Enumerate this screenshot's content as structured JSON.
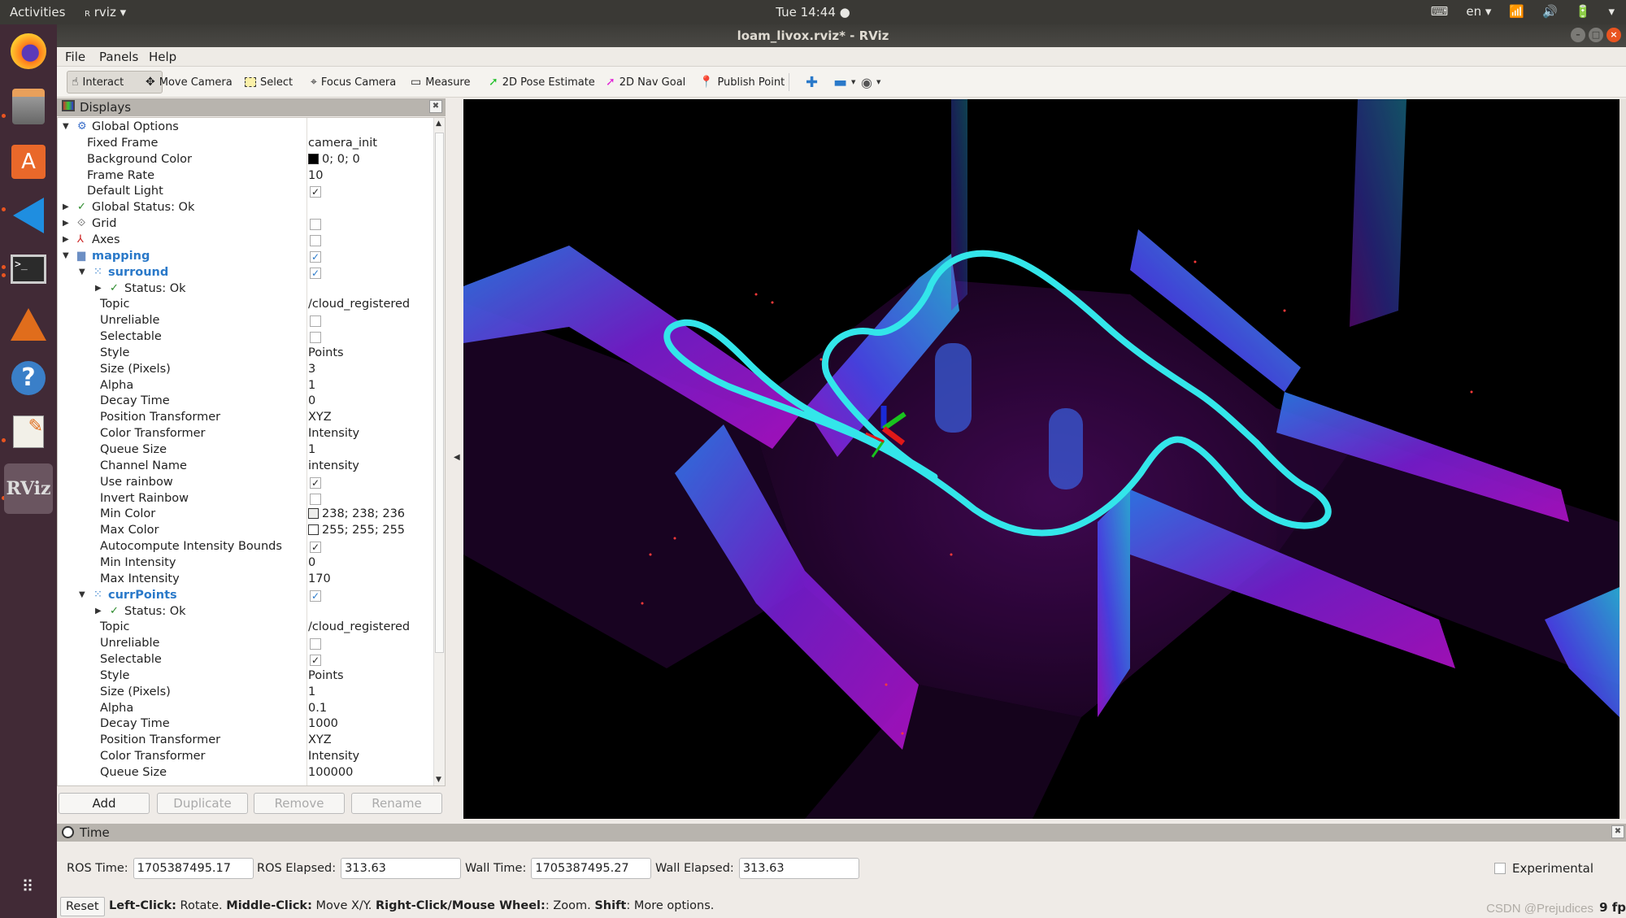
{
  "topbar": {
    "activities": "Activities",
    "app_name": "rviz",
    "clock": "Tue 14:44",
    "lang": "en"
  },
  "window": {
    "title": "loam_livox.rviz* - RViz"
  },
  "dock": {
    "apps": [
      "firefox",
      "files",
      "software-center",
      "vscode",
      "terminal",
      "matlab",
      "help",
      "text-editor",
      "rviz"
    ],
    "rviz_label": "RViz"
  },
  "menu": {
    "file": "File",
    "panels": "Panels",
    "help": "Help"
  },
  "toolbar": {
    "interact": "Interact",
    "move_camera": "Move Camera",
    "select": "Select",
    "focus_camera": "Focus Camera",
    "measure": "Measure",
    "pose_estimate": "2D Pose Estimate",
    "nav_goal": "2D Nav Goal",
    "publish_point": "Publish Point"
  },
  "displays": {
    "title": "Displays",
    "rows": [
      {
        "label": "Global Options",
        "value": "",
        "kind": "group",
        "indent": 0,
        "expanded": true
      },
      {
        "label": "Fixed Frame",
        "value": "camera_init",
        "indent": 1
      },
      {
        "label": "Background Color",
        "value": "0; 0; 0",
        "swatch": "#000000",
        "indent": 1
      },
      {
        "label": "Frame Rate",
        "value": "10",
        "indent": 1
      },
      {
        "label": "Default Light",
        "check": true,
        "indent": 1
      },
      {
        "label": "Global Status: Ok",
        "kind": "status",
        "indent": 0
      },
      {
        "label": "Grid",
        "check": false,
        "kind": "display",
        "indent": 0
      },
      {
        "label": "Axes",
        "check": false,
        "kind": "display",
        "indent": 0
      },
      {
        "label": "mapping",
        "check": true,
        "kind": "folder",
        "indent": 0,
        "expanded": true
      },
      {
        "label": "surround",
        "check": true,
        "kind": "cloud",
        "indent": 1,
        "expanded": true
      },
      {
        "label": "Status: Ok",
        "kind": "status",
        "indent": 2
      },
      {
        "label": "Topic",
        "value": "/cloud_registered",
        "indent": 2
      },
      {
        "label": "Unreliable",
        "check": false,
        "indent": 2
      },
      {
        "label": "Selectable",
        "check": false,
        "indent": 2
      },
      {
        "label": "Style",
        "value": "Points",
        "indent": 2
      },
      {
        "label": "Size (Pixels)",
        "value": "3",
        "indent": 2
      },
      {
        "label": "Alpha",
        "value": "1",
        "indent": 2
      },
      {
        "label": "Decay Time",
        "value": "0",
        "indent": 2
      },
      {
        "label": "Position Transformer",
        "value": "XYZ",
        "indent": 2
      },
      {
        "label": "Color Transformer",
        "value": "Intensity",
        "indent": 2
      },
      {
        "label": "Queue Size",
        "value": "1",
        "indent": 2
      },
      {
        "label": "Channel Name",
        "value": "intensity",
        "indent": 2
      },
      {
        "label": "Use rainbow",
        "check": true,
        "indent": 2
      },
      {
        "label": "Invert Rainbow",
        "check": false,
        "indent": 2
      },
      {
        "label": "Min Color",
        "value": "238; 238; 236",
        "swatch": "#eeeeec",
        "indent": 2
      },
      {
        "label": "Max Color",
        "value": "255; 255; 255",
        "swatch": "#ffffff",
        "indent": 2
      },
      {
        "label": "Autocompute Intensity Bounds",
        "check": true,
        "indent": 2
      },
      {
        "label": "Min Intensity",
        "value": "0",
        "indent": 2
      },
      {
        "label": "Max Intensity",
        "value": "170",
        "indent": 2
      },
      {
        "label": "currPoints",
        "check": true,
        "kind": "cloud",
        "indent": 1,
        "expanded": true
      },
      {
        "label": "Status: Ok",
        "kind": "status",
        "indent": 2
      },
      {
        "label": "Topic",
        "value": "/cloud_registered",
        "indent": 2
      },
      {
        "label": "Unreliable",
        "check": false,
        "indent": 2
      },
      {
        "label": "Selectable",
        "check": true,
        "indent": 2
      },
      {
        "label": "Style",
        "value": "Points",
        "indent": 2
      },
      {
        "label": "Size (Pixels)",
        "value": "1",
        "indent": 2
      },
      {
        "label": "Alpha",
        "value": "0.1",
        "indent": 2
      },
      {
        "label": "Decay Time",
        "value": "1000",
        "indent": 2
      },
      {
        "label": "Position Transformer",
        "value": "XYZ",
        "indent": 2
      },
      {
        "label": "Color Transformer",
        "value": "Intensity",
        "indent": 2
      },
      {
        "label": "Queue Size",
        "value": "100000",
        "indent": 2
      }
    ],
    "buttons": {
      "add": "Add",
      "duplicate": "Duplicate",
      "remove": "Remove",
      "rename": "Rename"
    }
  },
  "time": {
    "title": "Time",
    "ros_time_label": "ROS Time:",
    "ros_time": "1705387495.17",
    "ros_elapsed_label": "ROS Elapsed:",
    "ros_elapsed": "313.63",
    "wall_time_label": "Wall Time:",
    "wall_time": "1705387495.27",
    "wall_elapsed_label": "Wall Elapsed:",
    "wall_elapsed": "313.63",
    "experimental": "Experimental"
  },
  "statusbar": {
    "reset": "Reset",
    "hint_parts": [
      {
        "b": "Left-Click:",
        "t": " Rotate. "
      },
      {
        "b": "Middle-Click:",
        "t": " Move X/Y. "
      },
      {
        "b": "Right-Click/Mouse Wheel:",
        "t": ": Zoom. "
      },
      {
        "b": "Shift",
        "t": ": More options."
      }
    ],
    "fps": "9 fp",
    "watermark": "CSDN @Prejudices"
  },
  "view3d": {
    "background": "#000000",
    "trajectory_color": "#33e6ea",
    "point_cloud_colors": [
      "#7a1fd6",
      "#b012c8",
      "#3b6cf5",
      "#2ab7e0",
      "#e0246a"
    ]
  }
}
